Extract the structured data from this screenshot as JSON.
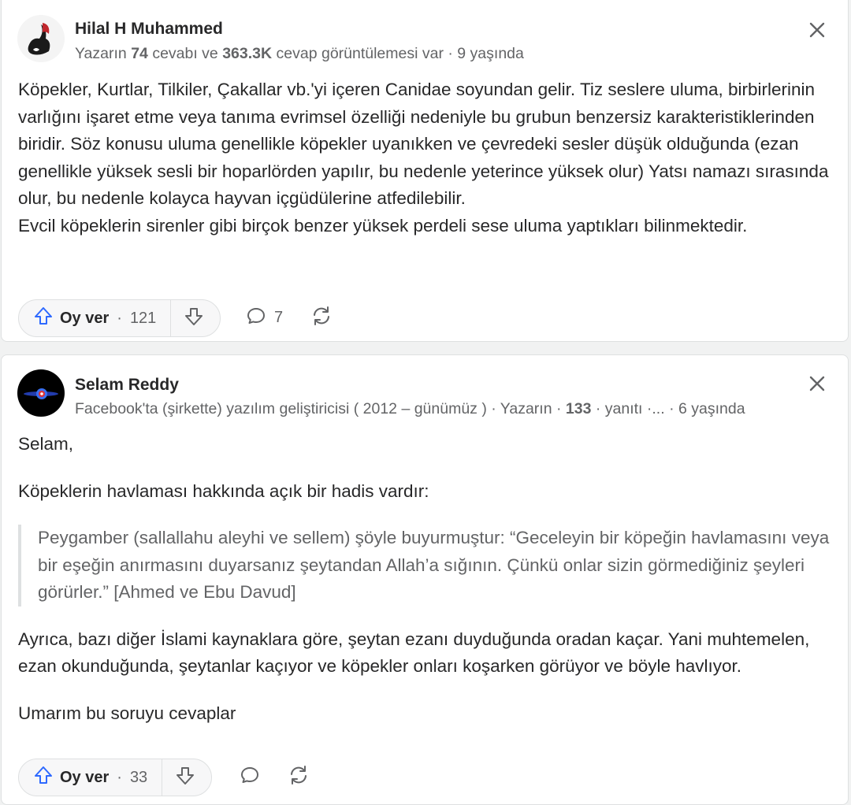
{
  "answers": [
    {
      "author": "Hilal H Muhammed",
      "meta": {
        "prefix": "Yazarın",
        "answers_count": "74",
        "mid": "cevabı ve",
        "views": "363.3K",
        "suffix": "cevap görüntülemesi var · 9 yaşında"
      },
      "paragraphs": [
        "Köpekler, Kurtlar, Tilkiler, Çakallar vb.'yi içeren Canidae soyundan gelir. Tiz seslere uluma, birbirlerinin varlığını işaret etme veya tanıma evrimsel özelliği nedeniyle bu grubun benzersiz karakteristiklerinden biridir. Söz konusu uluma genellikle köpekler uyanıkken ve çevredeki sesler düşük olduğunda (ezan genellikle yüksek sesli bir hoparlörden yapılır, bu nedenle yeterince yüksek olur) Yatsı namazı sırasında olur, bu nedenle kolayca hayvan içgüdülerine atfedilebilir.",
        "Evcil köpeklerin sirenler gibi birçok benzer yüksek perdeli sese uluma yaptıkları bilinmektedir."
      ],
      "actions": {
        "upvote_label": "Oy ver",
        "separator": "·",
        "upvote_count": "121",
        "comment_count": "7"
      }
    },
    {
      "author": "Selam Reddy",
      "meta": {
        "credential": "Facebook'ta (şirkette) yazılım geliştiricisi ( 2012 – günümüz ) · Yazarın ·",
        "answers_count": "133",
        "suffix": "· yanıtı ·...",
        "age": "· 6 yaşında"
      },
      "greeting": "Selam,",
      "intro": "Köpeklerin havlaması hakkında açık bir hadis vardır:",
      "quote": "Peygamber (sallallahu aleyhi ve sellem) şöyle buyurmuştur: “Geceleyin bir köpeğin havlamasını veya bir eşeğin anırmasını duyarsanız şeytandan Allah’a sığının. Çünkü onlar sizin görmediğiniz şeyleri görürler.” [Ahmed ve Ebu Davud]",
      "paragraph": "Ayrıca, bazı diğer İslami kaynaklara göre, şeytan ezanı duyduğunda oradan kaçar. Yani muhtemelen, ezan okunduğunda, şeytanlar kaçıyor ve köpekler onları koşarken görüyor ve böyle havlıyor.",
      "closing": "Umarım bu soruyu cevaplar",
      "actions": {
        "upvote_label": "Oy ver",
        "separator": "·",
        "upvote_count": "33"
      }
    }
  ],
  "colors": {
    "upvote_icon": "#2e69ff",
    "text": "#282829",
    "secondary": "#636466",
    "border": "#dee0e1"
  },
  "icons": [
    "close-icon",
    "upvote-arrow-icon",
    "downvote-arrow-icon",
    "comment-icon",
    "share-reshare-icon"
  ]
}
